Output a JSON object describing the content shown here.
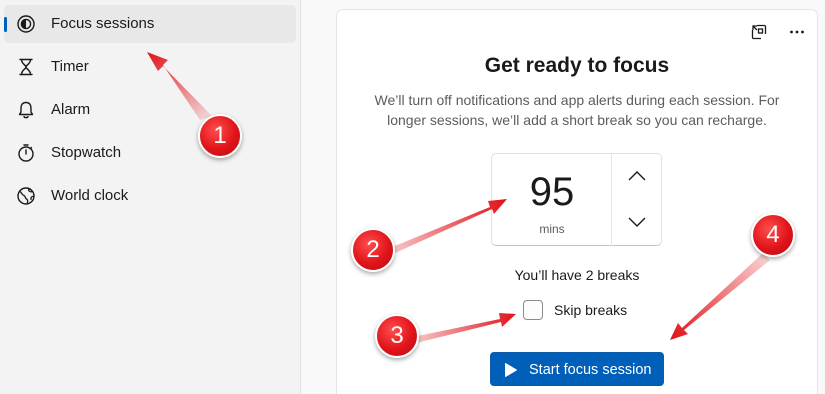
{
  "sidebar": {
    "items": [
      {
        "label": "Focus sessions",
        "icon": "focus-icon",
        "active": true
      },
      {
        "label": "Timer",
        "icon": "hourglass-icon",
        "active": false
      },
      {
        "label": "Alarm",
        "icon": "bell-icon",
        "active": false
      },
      {
        "label": "Stopwatch",
        "icon": "stopwatch-icon",
        "active": false
      },
      {
        "label": "World clock",
        "icon": "globe-icon",
        "active": false
      }
    ]
  },
  "card": {
    "toolbar": {
      "compact_icon": "compact-overlay-icon",
      "more_icon": "more-options-icon"
    },
    "title": "Get ready to focus",
    "description": "We’ll turn off notifications and app alerts during each session. For longer sessions, we’ll add a short break so you can recharge.",
    "duration": {
      "value": "95",
      "unit": "mins"
    },
    "breaks_text": "You’ll have 2 breaks",
    "skip_breaks": {
      "label": "Skip breaks",
      "checked": false
    },
    "start_button": {
      "label": "Start focus session",
      "icon": "play-icon"
    }
  },
  "annotations": [
    "1",
    "2",
    "3",
    "4"
  ],
  "colors": {
    "accent": "#005fb8",
    "annotation": "#e0141a"
  }
}
